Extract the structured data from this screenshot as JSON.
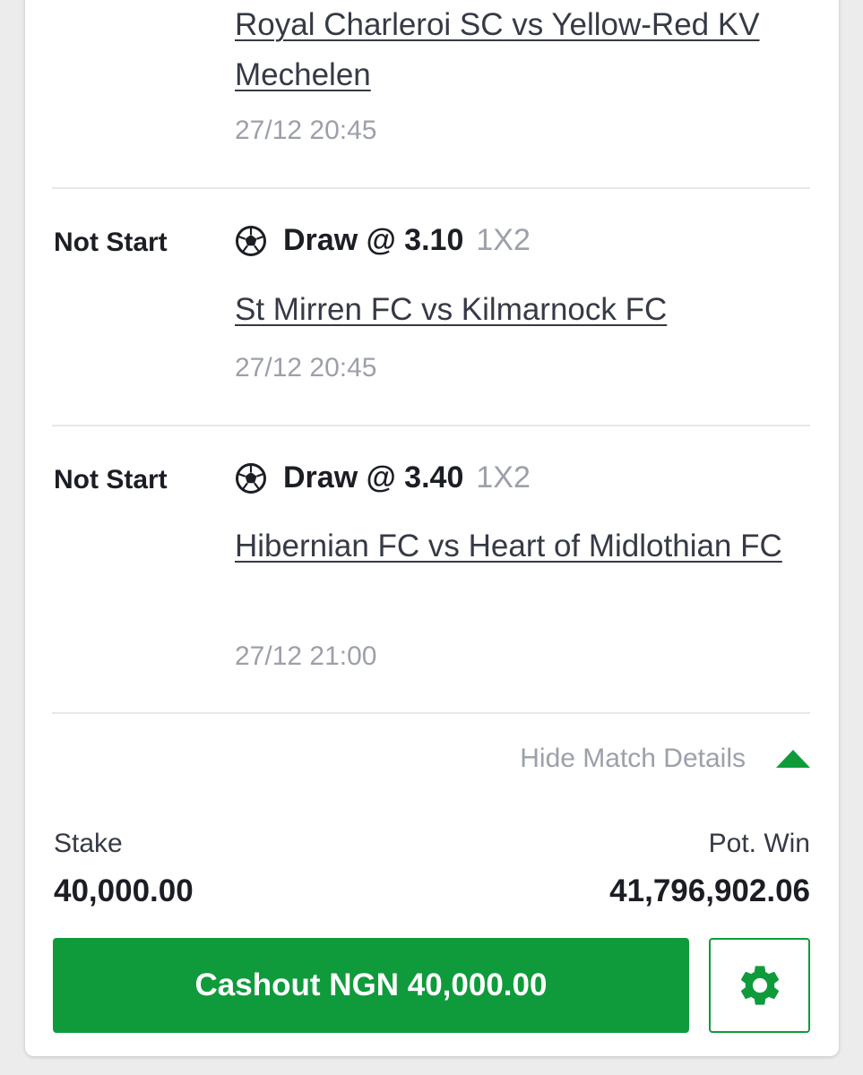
{
  "events": [
    {
      "teams": "Royal Charleroi SC vs Yellow-Red KV Mechelen",
      "time": "27/12 20:45"
    },
    {
      "status": "Not Start",
      "pick": "Draw @ 3.10",
      "market": "1X2",
      "sport_icon": "soccer-ball-icon",
      "teams": "St Mirren FC vs Kilmarnock FC",
      "time": "27/12 20:45"
    },
    {
      "status": "Not Start",
      "pick": "Draw @ 3.40",
      "market": "1X2",
      "sport_icon": "soccer-ball-icon",
      "teams": "Hibernian FC vs Heart of Midlothian FC",
      "time": "27/12 21:00"
    }
  ],
  "toggle": {
    "label": "Hide Match Details",
    "icon": "caret-up-icon"
  },
  "summary": {
    "stake_label": "Stake",
    "stake_value": "40,000.00",
    "potwin_label": "Pot. Win",
    "potwin_value": "41,796,902.06"
  },
  "actions": {
    "cashout_label": "Cashout NGN 40,000.00",
    "settings_icon": "gear-icon"
  },
  "colors": {
    "accent": "#0f9b3b",
    "muted_text": "#9ca0aa",
    "primary_text": "#1b1e24"
  }
}
